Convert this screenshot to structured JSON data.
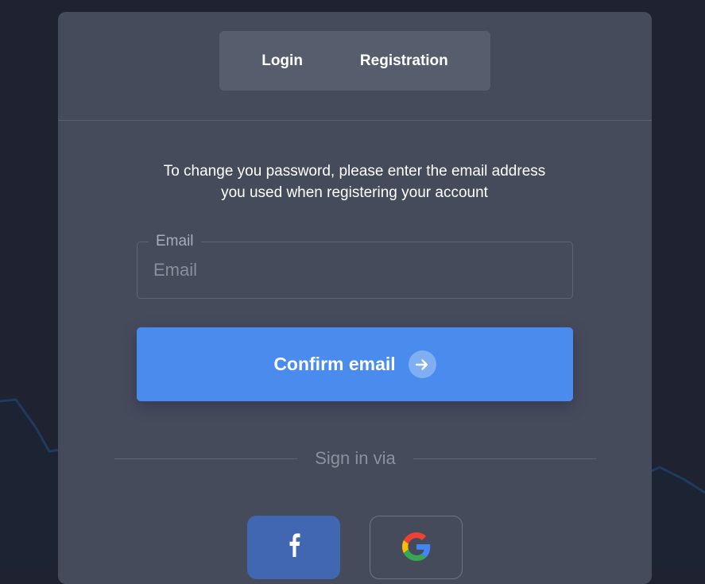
{
  "tabs": {
    "login": "Login",
    "registration": "Registration"
  },
  "instructions": {
    "line1": "To change you password, please enter the email address",
    "line2": "you used when registering your account"
  },
  "email_field": {
    "label": "Email",
    "placeholder": "Email",
    "value": ""
  },
  "confirm_button": {
    "label": "Confirm email",
    "icon": "arrow-right-icon"
  },
  "sign_in_via": "Sign in via",
  "social": [
    {
      "name": "facebook",
      "icon": "facebook-icon",
      "color": "#4267b2"
    },
    {
      "name": "google",
      "icon": "google-icon"
    }
  ],
  "colors": {
    "page_background": "#1f2231",
    "card_background": "#464b5c",
    "tabs_background": "#585d6e",
    "accent": "#4a8ced",
    "facebook": "#4267b2"
  }
}
